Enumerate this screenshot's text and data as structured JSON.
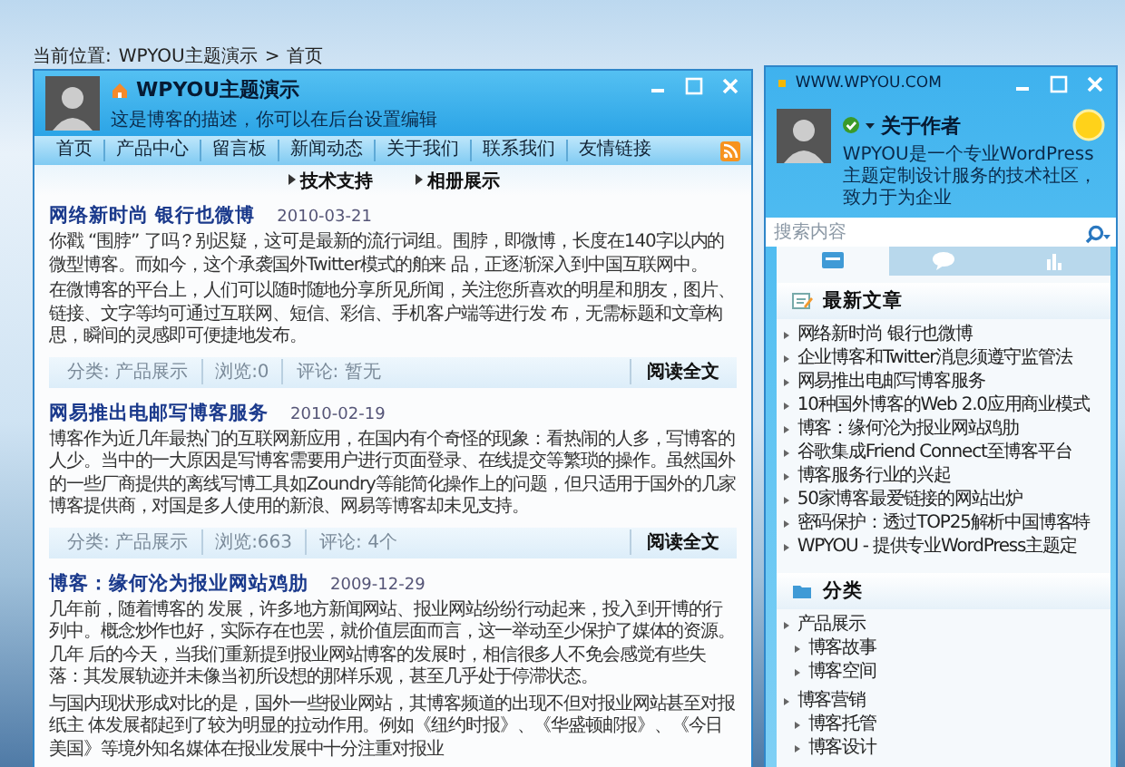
{
  "breadcrumb": {
    "label": "当前位置:",
    "items": [
      "WPYOU主题演示",
      "首页"
    ],
    "separator": ">"
  },
  "blog": {
    "title": "WPYOU主题演示",
    "description": "这是博客的描述，你可以在后台设置编辑",
    "nav": [
      "首页",
      "产品中心",
      "留言板",
      "新闻动态",
      "关于我们",
      "联系我们",
      "友情链接"
    ],
    "subnav": [
      "技术支持",
      "相册展示"
    ]
  },
  "posts": [
    {
      "title": "网络新时尚 银行也微博",
      "date": "2010-03-21",
      "paragraphs": [
        "你戳 “围脖” 了吗？别迟疑，这可是最新的流行词组。围脖，即微博，长度在140字以内的微型博客。而如今，这个承袭国外Twitter模式的舶来 品，正逐渐深入到中国互联网中。",
        "在微博客的平台上，人们可以随时随地分享所见所闻，关注您所喜欢的明星和朋友，图片、链接、文字等均可通过互联网、短信、彩信、手机客户端等进行发 布，无需标题和文章构思，瞬间的灵感即可便捷地发布。"
      ],
      "meta": [
        "分类: 产品展示",
        "浏览:0",
        "评论: 暂无"
      ],
      "read_more": "阅读全文"
    },
    {
      "title": "网易推出电邮写博客服务",
      "date": "2010-02-19",
      "paragraphs": [
        "博客作为近几年最热门的互联网新应用，在国内有个奇怪的现象：看热闹的人多，写博客的人少。当中的一大原因是写博客需要用户进行页面登录、在线提交等繁琐的操作。虽然国外的一些厂商提供的离线写博工具如Zoundry等能简化操作上的问题，但只适用于国外的几家博客提供商，对国是多人使用的新浪、网易等博客却未见支持。"
      ],
      "meta": [
        "分类: 产品展示",
        "浏览:663",
        "评论: 4个"
      ],
      "read_more": "阅读全文"
    },
    {
      "title": "博客：缘何沦为报业网站鸡肋",
      "date": "2009-12-29",
      "paragraphs": [
        "几年前，随着博客的 发展，许多地方新闻网站、报业网站纷纷行动起来，投入到开博的行列中。概念炒作也好，实际存在也罢，就价值层面而言，这一举动至少保护了媒体的资源。几年 后的今天，当我们重新提到报业网站博客的发展时，相信很多人不免会感觉有些失落：其发展轨迹并未像当初所设想的那样乐观，甚至几乎处于停滞状态。",
        "与国内现状形成对比的是，国外一些报业网站，其博客频道的出现不但对报业网站甚至对报纸主 体发展都起到了较为明显的拉动作用。例如《纽约时报》、《华盛顿邮报》、《今日美国》等境外知名媒体在报业发展中十分注重对报业"
      ]
    }
  ],
  "sidebar": {
    "url": "WWW.WPYOU.COM",
    "author_title": "关于作者",
    "author_bio": "WPYOU是一个专业WordPress主题定制设计服务的技术社区，致力于为企业",
    "search": {
      "placeholder": "搜索内容"
    },
    "tabs": [
      {
        "kind": "document",
        "selected": true
      },
      {
        "kind": "chat",
        "selected": false
      },
      {
        "kind": "chart",
        "selected": false
      }
    ],
    "recent": {
      "title": "最新文章",
      "items": [
        "网络新时尚 银行也微博",
        "企业博客和Twitter消息须遵守监管法",
        "网易推出电邮写博客服务",
        "10种国外博客的Web 2.0应用商业模式",
        "博客：缘何沦为报业网站鸡肋",
        "谷歌集成Friend Connect至博客平台",
        "博客服务行业的兴起",
        "50家博客最爱链接的网站出炉",
        "密码保护：透过TOP25解析中国博客特",
        "WPYOU - 提供专业WordPress主题定"
      ]
    },
    "categories": {
      "title": "分类",
      "items": [
        {
          "label": "产品展示",
          "children": [
            {
              "label": "博客故事"
            },
            {
              "label": "博客空间"
            }
          ]
        },
        {
          "label": "博客营销",
          "children": [
            {
              "label": "博客托管"
            },
            {
              "label": "博客设计"
            }
          ]
        }
      ]
    }
  }
}
